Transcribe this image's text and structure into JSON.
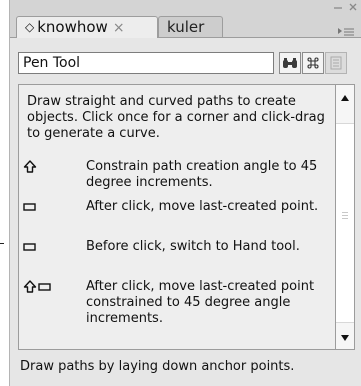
{
  "tabs": [
    {
      "label": "knowhow",
      "active": true,
      "icon": "diamond-icon",
      "close": "×"
    },
    {
      "label": "kuler",
      "active": false
    }
  ],
  "search": {
    "value": "Pen Tool"
  },
  "toolbar": {
    "binoculars": "binoculars-icon",
    "command": "command-key-icon",
    "doc": "document-icon"
  },
  "content": {
    "description": "Draw straight and curved paths to create objects. Click once for a corner and click-drag to generate a curve.",
    "shortcuts": [
      {
        "modifiers": [
          "shift"
        ],
        "text": "Constrain path creation angle to 45 degree increments."
      },
      {
        "modifiers": [
          "key"
        ],
        "text": "After click, move last-created point."
      },
      {
        "modifiers": [
          "key"
        ],
        "text": "Before click, switch to Hand tool."
      },
      {
        "modifiers": [
          "shift",
          "key"
        ],
        "text": "After click, move last-created point constrained to 45 degree angle increments."
      }
    ]
  },
  "status_text": "Draw paths by laying down anchor points.",
  "colors": {
    "panel": "#e6e6e6",
    "tabstrip": "#d4d4d4",
    "content": "#eeeeee"
  }
}
